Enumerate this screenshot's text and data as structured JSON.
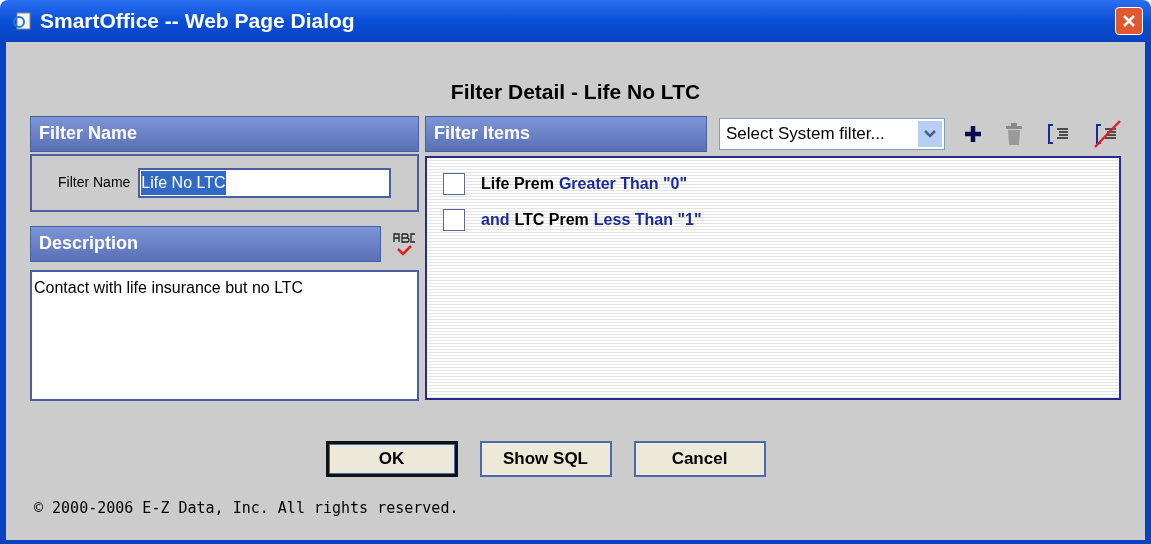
{
  "window": {
    "title": "SmartOffice -- Web Page Dialog"
  },
  "heading": "Filter Detail - Life No LTC",
  "filter_name_section": {
    "header": "Filter Name",
    "label": "Filter Name",
    "value": "Life No LTC",
    "text_selected": true
  },
  "description_section": {
    "header": "Description",
    "value": "Contact with life insurance but no LTC"
  },
  "filter_items_section": {
    "header": "Filter Items",
    "system_filter_select": "Select System filter...",
    "items": [
      {
        "checked": false,
        "parts": [
          {
            "kind": "field",
            "text": "Life Prem"
          },
          {
            "kind": "condition",
            "text": "Greater Than \"0\""
          }
        ]
      },
      {
        "checked": false,
        "parts": [
          {
            "kind": "conjunction",
            "text": "and"
          },
          {
            "kind": "field",
            "text": "LTC Prem"
          },
          {
            "kind": "condition",
            "text": "Less Than \"1\""
          }
        ]
      }
    ]
  },
  "buttons": [
    {
      "label": "OK",
      "default": true
    },
    {
      "label": "Show SQL",
      "default": false
    },
    {
      "label": "Cancel",
      "default": false
    }
  ],
  "copyright": "© 2000-2006 E-Z Data, Inc. All rights reserved."
}
